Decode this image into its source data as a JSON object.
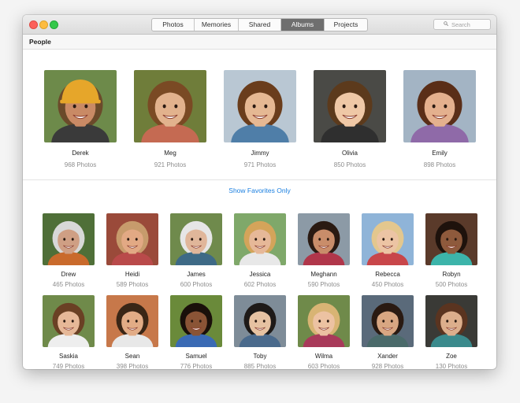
{
  "tabs": [
    "Photos",
    "Memories",
    "Shared",
    "Albums",
    "Projects"
  ],
  "active_tab": "Albums",
  "search": {
    "placeholder": "Search"
  },
  "section": {
    "title": "People"
  },
  "favorites": [
    {
      "name": "Derek",
      "count": "968 Photos",
      "skin": "#c98a65",
      "hair": "#6b4a2a",
      "bg": "#6d8a4a",
      "shirt": "#3a3a3a",
      "helmet": "#e6a62a"
    },
    {
      "name": "Meg",
      "count": "921 Photos",
      "skin": "#e2b28d",
      "hair": "#7a4a24",
      "bg": "#6f7d3a",
      "shirt": "#c56a52"
    },
    {
      "name": "Jimmy",
      "count": "971 Photos",
      "skin": "#e5b893",
      "hair": "#6a3d1c",
      "bg": "#b9c7d3",
      "shirt": "#4f7ea8"
    },
    {
      "name": "Olivia",
      "count": "850 Photos",
      "skin": "#efc8a6",
      "hair": "#5c3a1c",
      "bg": "#4a4a46",
      "shirt": "#2f2f2f"
    },
    {
      "name": "Emily",
      "count": "898 Photos",
      "skin": "#e4b08e",
      "hair": "#5a2e18",
      "bg": "#a3b4c4",
      "shirt": "#8f6aa8"
    }
  ],
  "show_favorites": "Show Favorites Only",
  "people": [
    {
      "name": "Drew",
      "count": "465 Photos",
      "skin": "#cf9f84",
      "hair": "#d8d8d8",
      "bg": "#4f6f38",
      "shirt": "#c96a2c"
    },
    {
      "name": "Heidi",
      "count": "589 Photos",
      "skin": "#e2a984",
      "hair": "#c79b6c",
      "bg": "#9a4a3a",
      "shirt": "#b94a4a"
    },
    {
      "name": "James",
      "count": "600 Photos",
      "skin": "#e0b69a",
      "hair": "#e6e6e6",
      "bg": "#6f8a4c",
      "shirt": "#3e6a86"
    },
    {
      "name": "Jessica",
      "count": "602 Photos",
      "skin": "#e6b898",
      "hair": "#d4a45a",
      "bg": "#7fa86a",
      "shirt": "#e8e8e8"
    },
    {
      "name": "Meghann",
      "count": "590 Photos",
      "skin": "#c98d6a",
      "hair": "#2a1a12",
      "bg": "#8c9aa6",
      "shirt": "#b0364a"
    },
    {
      "name": "Rebecca",
      "count": "450 Photos",
      "skin": "#ecc4a4",
      "hair": "#e3c78e",
      "bg": "#8fb4d8",
      "shirt": "#c8464a"
    },
    {
      "name": "Robyn",
      "count": "500 Photos",
      "skin": "#8e5a3c",
      "hair": "#1e120c",
      "bg": "#5a3a2a",
      "shirt": "#3cb4aa"
    },
    {
      "name": "Saskia",
      "count": "749 Photos",
      "skin": "#e6b898",
      "hair": "#6a4024",
      "bg": "#6f8a4a",
      "shirt": "#eeeeee"
    },
    {
      "name": "Sean",
      "count": "398 Photos",
      "skin": "#e2ac86",
      "hair": "#3a2616",
      "bg": "#c7784a",
      "shirt": "#e8e8e8"
    },
    {
      "name": "Samuel",
      "count": "776 Photos",
      "skin": "#8a5436",
      "hair": "#1a100a",
      "bg": "#6a8a3a",
      "shirt": "#3a6ab4"
    },
    {
      "name": "Toby",
      "count": "885 Photos",
      "skin": "#e6c2a2",
      "hair": "#1e1a18",
      "bg": "#7e8c98",
      "shirt": "#4a6a8c"
    },
    {
      "name": "Wilma",
      "count": "603 Photos",
      "skin": "#ecc2a2",
      "hair": "#d8b474",
      "bg": "#6f8a4a",
      "shirt": "#a83a5a"
    },
    {
      "name": "Xander",
      "count": "928 Photos",
      "skin": "#d8a682",
      "hair": "#2a1a12",
      "bg": "#5a6a7a",
      "shirt": "#4a6a6a"
    },
    {
      "name": "Zoe",
      "count": "130 Photos",
      "skin": "#dcae8c",
      "hair": "#5a3420",
      "bg": "#3a3a36",
      "shirt": "#3a8a8c"
    }
  ]
}
